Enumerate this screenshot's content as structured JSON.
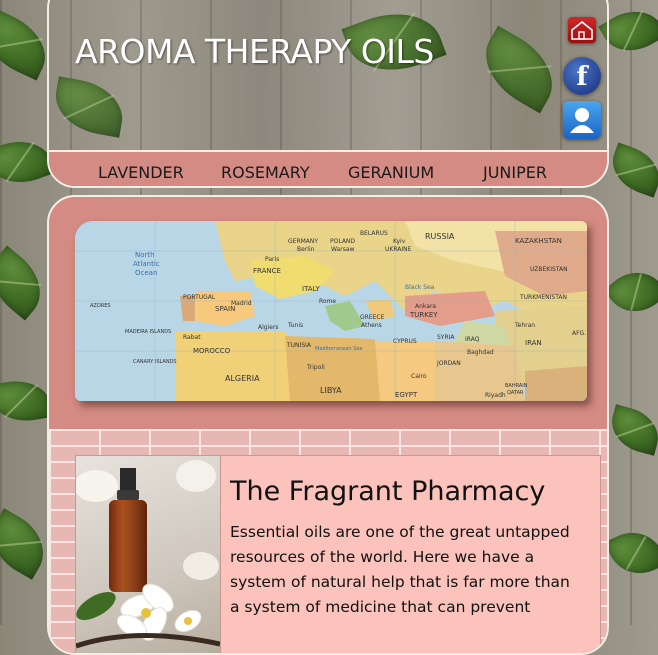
{
  "site": {
    "title": "AROMA THERAPY OILS"
  },
  "nav": {
    "items": [
      "LAVENDER",
      "ROSEMARY",
      "GERANIUM",
      "JUNIPER"
    ]
  },
  "social": {
    "icons": [
      "home-icon",
      "facebook-icon",
      "user-profile-icon"
    ]
  },
  "map": {
    "labels": {
      "russia": "RUSSIA",
      "kazakhstan": "KAZAKHSTAN",
      "north_atlantic": "North",
      "atlantic": "Atlantic",
      "ocean": "Ocean",
      "france": "FRANCE",
      "germany": "GERMANY",
      "poland": "POLAND",
      "belarus": "BELARUS",
      "ukraine": "UKRAINE",
      "spain": "SPAIN",
      "portugal": "PORTUGAL",
      "italy": "ITALY",
      "turkey": "TURKEY",
      "iran": "IRAN",
      "iraq": "IRAQ",
      "syria": "SYRIA",
      "morocco": "MOROCCO",
      "algeria": "ALGERIA",
      "libya": "LIBYA",
      "egypt": "EGYPT",
      "tunisia": "TUNISIA",
      "greece": "GREECE",
      "tehran": "Tehran",
      "baghdad": "Baghdad",
      "ankara": "Ankara",
      "madrid": "Madrid",
      "paris": "Paris",
      "algiers": "Algiers",
      "tunis": "Tunis",
      "cairo": "Cairo",
      "mediterranean": "Mediterranean Sea",
      "black_sea": "Black Sea",
      "azores": "AZORES",
      "madeira": "MADEIRA ISLANDS",
      "canary": "CANARY ISLANDS",
      "kyiv": "Kyiv",
      "warsaw": "Warsaw",
      "berlin": "Berlin",
      "rome": "Rome",
      "athens": "Athens",
      "turkmenistan": "TURKMENISTAN",
      "uzbekistan": "UZBEKISTAN",
      "jordan": "JORDAN",
      "cyprus": "CYPRUS",
      "riyadh": "Riyadh",
      "bahrain": "BAHRAIN",
      "qatar": "QATAR",
      "afg": "AFG.",
      "tripoli": "Tripoli",
      "rabat": "Rabat"
    }
  },
  "article": {
    "title": "The Fragrant Pharmacy",
    "body": "Essential oils are one of the great untapped resources of the world. Here we have a system of natural help that is far more than a system of medicine that can prevent"
  },
  "colors": {
    "nav_bg": "#d38b83",
    "panel_bg": "#d38b83",
    "card_bg": "#fbc3bb",
    "brick": "#e7b7b4",
    "border": "#f4eee6"
  }
}
